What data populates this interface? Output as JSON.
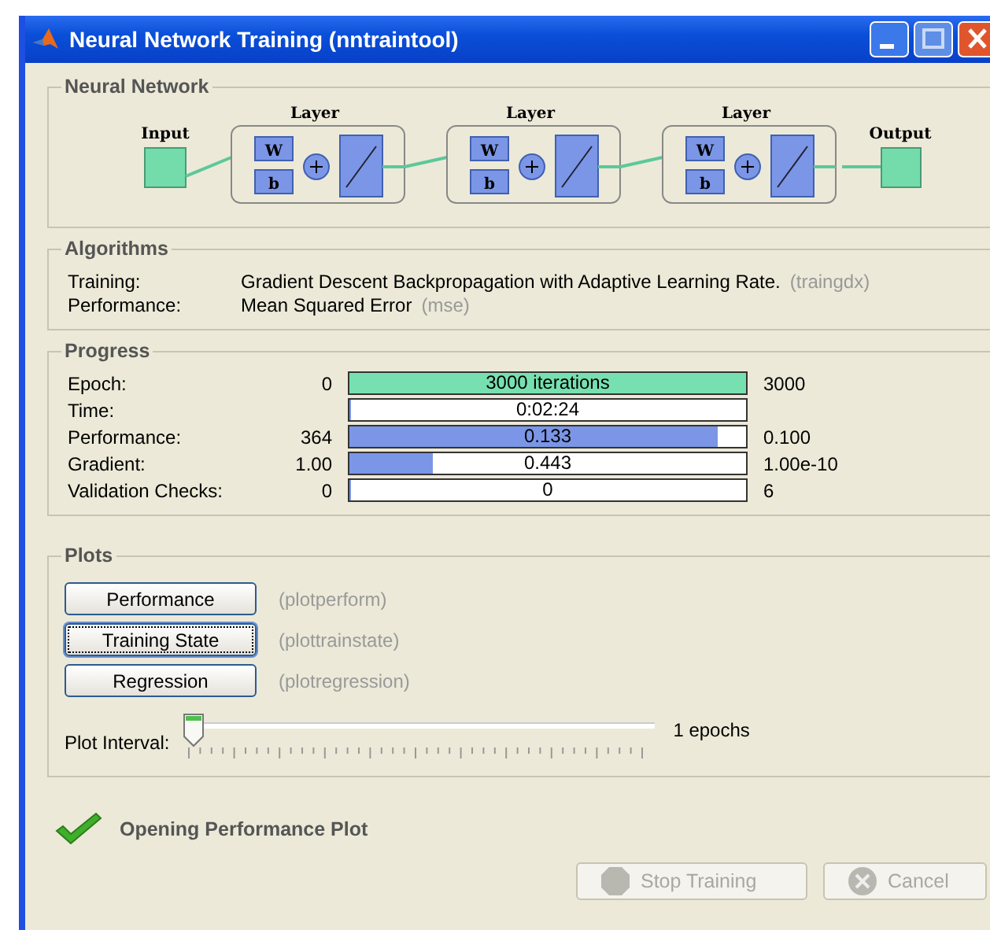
{
  "window": {
    "title": "Neural Network Training (nntraintool)"
  },
  "network": {
    "title": "Neural Network",
    "input_label": "Input",
    "output_label": "Output",
    "layers": [
      {
        "label": "Layer",
        "weight": "W",
        "bias": "b"
      },
      {
        "label": "Layer",
        "weight": "W",
        "bias": "b"
      },
      {
        "label": "Layer",
        "weight": "W",
        "bias": "b"
      }
    ]
  },
  "algorithms": {
    "title": "Algorithms",
    "rows": [
      {
        "label": "Training:",
        "value": "Gradient Descent Backpropagation with Adaptive Learning Rate.",
        "code": "(traingdx)"
      },
      {
        "label": "Performance:",
        "value": "Mean Squared Error",
        "code": "(mse)"
      }
    ]
  },
  "progress": {
    "title": "Progress",
    "rows": [
      {
        "label": "Epoch:",
        "min": "0",
        "text": "3000 iterations",
        "level": 1,
        "color": "#77e0b0",
        "max": "3000"
      },
      {
        "label": "Time:",
        "text": "0:02:24",
        "level": 0,
        "color": "#7b96e6"
      },
      {
        "label": "Performance:",
        "min": "364",
        "text": "0.133",
        "level": 0.93,
        "color": "#7b96e6",
        "max": "0.100"
      },
      {
        "label": "Gradient:",
        "min": "1.00",
        "text": "0.443",
        "level": 0.21,
        "color": "#7b96e6",
        "max": "1.00e-10"
      },
      {
        "label": "Validation Checks:",
        "min": "0",
        "text": "0",
        "level": 0,
        "color": "#7b96e6",
        "max": "6"
      }
    ]
  },
  "plots": {
    "title": "Plots",
    "buttons": [
      {
        "label": "Performance",
        "code": "(plotperform)",
        "focused": false
      },
      {
        "label": "Training State",
        "code": "(plottrainstate)",
        "focused": true
      },
      {
        "label": "Regression",
        "code": "(plotregression)",
        "focused": false
      }
    ],
    "interval_label": "Plot Interval:",
    "slider": {
      "level": 0
    },
    "interval_value": "1 epochs"
  },
  "status": "Opening Performance Plot",
  "buttons": [
    {
      "label": "Stop Training",
      "kind": "stop",
      "disabled": true
    },
    {
      "label": "Cancel",
      "kind": "cancel",
      "disabled": true
    }
  ]
}
